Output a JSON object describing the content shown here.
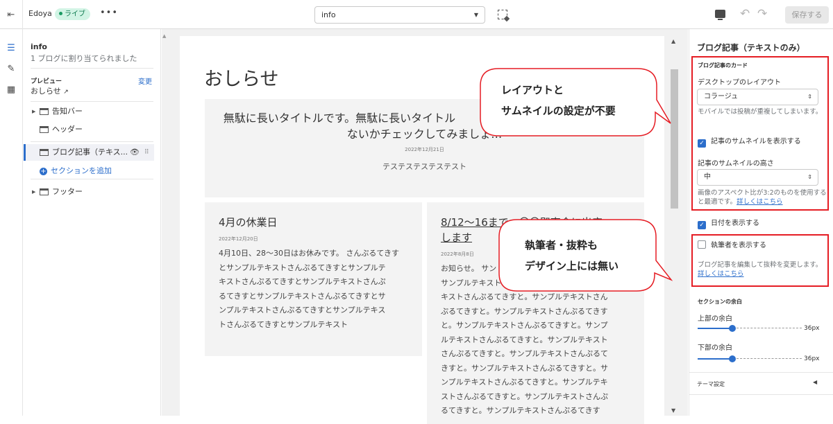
{
  "topbar": {
    "store_name": "Edoya",
    "live_label": "ライブ",
    "more_label": "•••",
    "page_select": "info",
    "save_label": "保存する"
  },
  "left_panel": {
    "template_title": "info",
    "template_sub": "1 ブログに割り当てられました",
    "preview_label": "プレビュー",
    "change_label": "変更",
    "preview_value": "おしらせ",
    "sections": [
      {
        "label": "告知バー"
      },
      {
        "label": "ヘッダー"
      },
      {
        "label": "ブログ記事（テキス..."
      },
      {
        "label": "フッター"
      }
    ],
    "add_section": "セクションを追加"
  },
  "preview": {
    "page_title": "おしらせ",
    "featured": {
      "title": "無駄に長いタイトルです。無駄に長いタイトル　　　　　　　　　　　　　　 らないかチェックしてみましょ…",
      "date": "2022年12月21日",
      "excerpt": "テステステステステスト"
    },
    "card1": {
      "title": "4月の休業日",
      "date": "2022年12月20日",
      "lines": [
        "4月10日、28～30日はお休みです。 さんぷるてきす",
        "とサンプルテキストさんぷるてきすとサンプルテ",
        "キストさんぷるてきすとサンプルテキストさんぷ",
        "るてきすとサンプルテキストさんぷるてきすとサ",
        "ンプルテキストさんぷるてきすとサンプルテキス",
        "トさんぷるてきすとサンプルテキスト"
      ]
    },
    "card2": {
      "title_lines": [
        "8/12～16まで　〇〇即売会に出店",
        "します"
      ],
      "date": "2022年8月8日",
      "lines": [
        "お知らせ。 サン",
        "サンプルテキスト",
        "キストさんぷるてきすと。サンプルテキストさん",
        "ぷるてきすと。サンプルテキストさんぷるてきす",
        "と。サンプルテキストさんぷるてきすと。サンプ",
        "ルテキストさんぷるてきすと。サンプルテキスト",
        "さんぷるてきすと。サンプルテキストさんぷるて",
        "きすと。サンプルテキストさんぷるてきすと。サ",
        "ンプルテキストさんぷるてきすと。サンプルテキ",
        "ストさんぷるてきすと。サンプルテキストさんぷ",
        "るてきすと。サンプルテキストさんぷるてきす"
      ]
    }
  },
  "right_panel": {
    "title": "ブログ記事（テキストのみ）",
    "card_group": "ブログ記事のカード",
    "desktop_layout_label": "デスクトップのレイアウト",
    "desktop_layout_value": "コラージュ",
    "desktop_layout_help": "モバイルでは投稿が重複してしまいます。",
    "show_thumbnail": "記事のサムネイルを表示する",
    "thumb_height_label": "記事のサムネイルの高さ",
    "thumb_height_value": "中",
    "thumb_help": "画像のアスペクト比が3:2のものを使用すると最適です。",
    "learn_more": "詳しくはこちら",
    "show_date": "日付を表示する",
    "show_author": "執筆者を表示する",
    "excerpt_help": "ブログ記事を編集して抜粋を変更します。",
    "learn_more2": "詳しくはこちら",
    "margin_group": "セクションの余白",
    "top_margin_label": "上部の余白",
    "top_margin_value": "36px",
    "top_margin_level": 0.33,
    "bottom_margin_label": "下部の余白",
    "bottom_margin_value": "36px",
    "bottom_margin_level": 0.33,
    "theme_settings": "テーマ設定"
  },
  "annotations": {
    "bubble1": [
      "レイアウトと",
      "サムネイルの設定が不要"
    ],
    "bubble2": [
      "執筆者・抜粋も",
      "デザイン上には無い"
    ]
  },
  "colors": {
    "accent": "#2c6ecb",
    "annotation_red": "#e51c23",
    "live_badge": "#d2f4e5"
  }
}
